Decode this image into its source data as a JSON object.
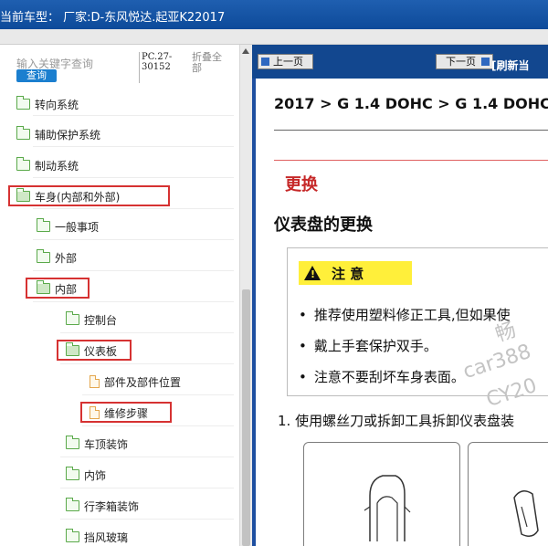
{
  "header": {
    "title": "当前车型： 厂家:D-东风悦达.起亚K22017"
  },
  "search": {
    "placeholder": "输入关键字查询",
    "button": "查询",
    "pc_code": "PC.27-30152",
    "collapse_all": "折叠全部"
  },
  "tree": {
    "items": [
      {
        "label": "转向系统"
      },
      {
        "label": "辅助保护系统"
      },
      {
        "label": "制动系统"
      },
      {
        "label": "车身(内部和外部)"
      },
      {
        "label": "一般事项"
      },
      {
        "label": "外部"
      },
      {
        "label": "内部"
      },
      {
        "label": "控制台"
      },
      {
        "label": "仪表板"
      },
      {
        "label": "部件及部件位置"
      },
      {
        "label": "维修步骤"
      },
      {
        "label": "车顶装饰"
      },
      {
        "label": "内饰"
      },
      {
        "label": "行李箱装饰"
      },
      {
        "label": "挡风玻璃"
      }
    ]
  },
  "nav": {
    "prev": "上一页",
    "next": "下一页",
    "refresh": "[刷新当"
  },
  "doc": {
    "breadcrumb": "2017 > G 1.4 DOHC > G 1.4 DOHC",
    "section": "更换",
    "heading": "仪表盘的更换",
    "caution": {
      "label": "注 意",
      "bullets": [
        "推荐使用塑料修正工具,但如果使",
        "戴上手套保护双手。",
        "注意不要刮坏车身表面。"
      ]
    },
    "watermarks": [
      "畅",
      "car388",
      "CY20"
    ],
    "step": "1.  使用螺丝刀或拆卸工具拆卸仪表盘装"
  },
  "colors": {
    "accent": "#12478f",
    "highlight": "#d63232",
    "section_red": "#c62828",
    "caution_yellow": "#ffef3a"
  }
}
